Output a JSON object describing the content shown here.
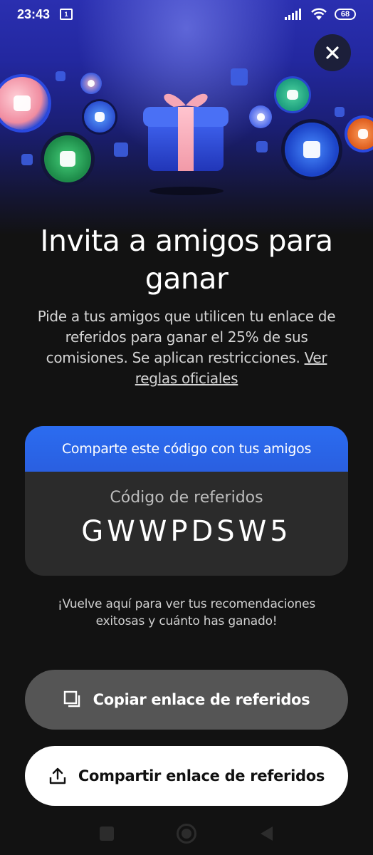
{
  "status_bar": {
    "time": "23:43",
    "sim_indicator": "1",
    "battery": "68",
    "icons": [
      "signal-icon",
      "wifi-icon",
      "battery-icon"
    ]
  },
  "close_button": {
    "icon": "close-icon"
  },
  "title": "Invita a amigos para ganar",
  "description": {
    "text": "Pide a tus amigos que utilicen tu enlace de referidos para ganar el 25% de sus comisiones. Se aplican restricciones. ",
    "link": "Ver reglas oficiales"
  },
  "code_card": {
    "header": "Comparte este código con tus amigos",
    "label": "Código de referidos",
    "code": "GWWPDSW5"
  },
  "note": "¡Vuelve aquí para ver tus recomendaciones exitosas y cuánto has ganado!",
  "buttons": {
    "copy": {
      "label": "Copiar enlace de referidos",
      "icon": "copy-icon"
    },
    "share": {
      "label": "Compartir enlace de referidos",
      "icon": "share-icon"
    }
  },
  "navigation": [
    "recents-button",
    "home-button",
    "back-button"
  ],
  "colors": {
    "background": "#121212",
    "hero_blue": "#2328a0",
    "accent_blue": "#2b6cf0",
    "card": "#2b2b2b",
    "copy_button": "#555555",
    "share_button": "#ffffff",
    "gift_box": "#2f52e0",
    "ribbon": "#f4a6b8"
  }
}
